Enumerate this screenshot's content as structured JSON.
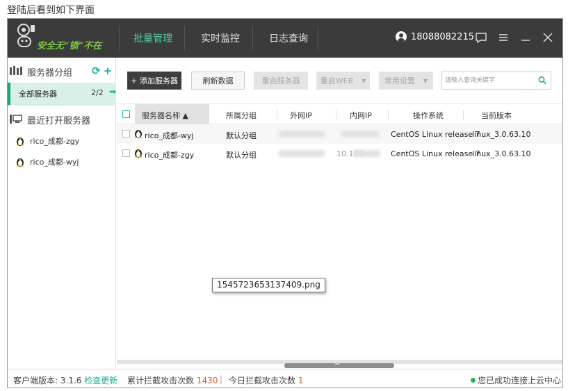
{
  "caption": "登陆后看到如下界面",
  "window": {
    "logo_text": "安全无“锁”不在",
    "nav": [
      "批量管理",
      "实时监控",
      "日志查询"
    ],
    "user_phone": "18088082215"
  },
  "sidebar": {
    "group_label": "服务器分组",
    "all_label": "全部服务器",
    "all_count": "2/2",
    "recent_label": "最近打开服务器",
    "recent_items": [
      "rico_成都-zgy",
      "rico_成都-wyj"
    ]
  },
  "toolbar": {
    "add_label": "+ 添加服务器",
    "refresh_label": "刷新数据",
    "restart_server_label": "重启服务器",
    "restart_web_label": "重启WEB",
    "settings_label": "常用设置",
    "search_placeholder": "请输入查询关键字"
  },
  "table": {
    "headers": [
      "服务器名称 ▲",
      "所属分组",
      "外网IP",
      "内网IP",
      "操作系统",
      "当前版本"
    ],
    "rows": [
      {
        "name": "rico_成都-wyj",
        "group": "默认分组",
        "ext_ip": "",
        "int_ip": "",
        "os": "CentOS Linux release 7",
        "version": "linux_3.0.63.10"
      },
      {
        "name": "rico_成都-zgy",
        "group": "默认分组",
        "ext_ip": "",
        "int_ip": "10.100",
        "os": "CentOS Linux release 7",
        "version": "linux_3.0.63.10"
      }
    ]
  },
  "tooltip": "1545723653137409.png",
  "status": {
    "client_label": "客户端版本:",
    "client_version": "3.1.6",
    "check_update": "检查更新",
    "total_label": "累计拦截攻击次数",
    "total_count": "1430",
    "today_label": "今日拦截攻击次数",
    "today_count": "1",
    "connection": "您已成功连接上云中心"
  },
  "colors": {
    "accent": "#19b394",
    "titlebar": "#3b3b3b",
    "count_highlight": "#e05a2e",
    "online": "#2bb34a"
  }
}
